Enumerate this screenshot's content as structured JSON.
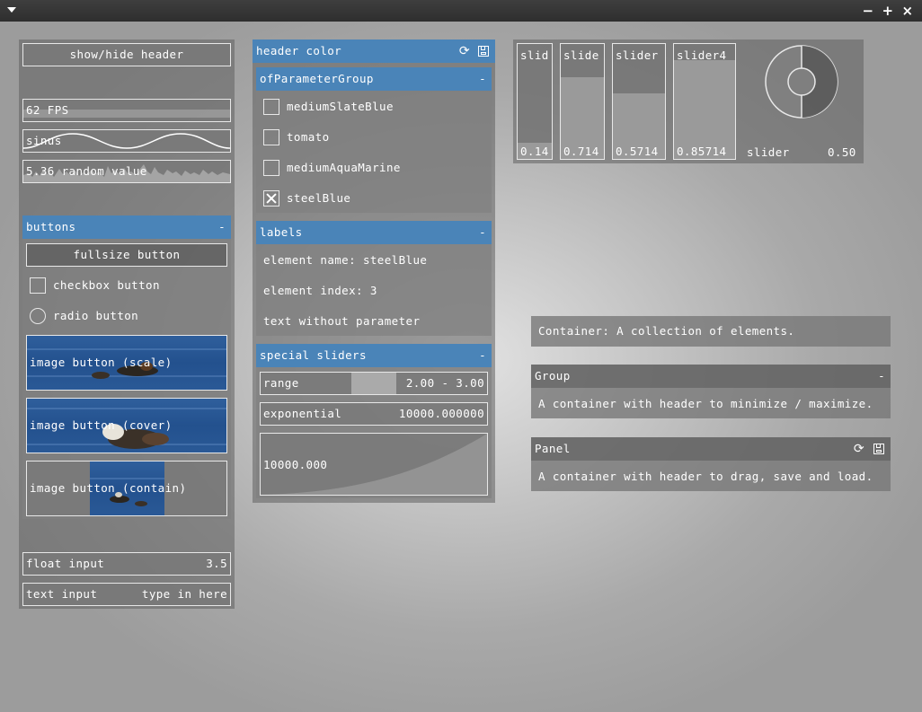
{
  "window": {
    "menu_icon": "chevron-down-icon",
    "controls": {
      "minimize": "−",
      "maximize": "+",
      "close": "×"
    }
  },
  "left": {
    "show_hide_header": "show/hide header",
    "fps": "62 FPS",
    "sinus": "sinus",
    "random": "5.36 random value",
    "buttons": {
      "header": "buttons",
      "minimize": "-",
      "fullsize": "fullsize button",
      "checkbox": "checkbox button",
      "radio": "radio button",
      "image_scale": "image button (scale)",
      "image_cover": "image button (cover)",
      "image_contain": "image button (contain)"
    },
    "float_input": {
      "label": "float input",
      "value": "3.5"
    },
    "text_input": {
      "label": "text input",
      "value": "type in here"
    }
  },
  "middle": {
    "header_color": "header color",
    "param_group": {
      "header": "ofParameterGroup",
      "minimize": "-",
      "items": [
        {
          "label": "mediumSlateBlue",
          "checked": false
        },
        {
          "label": "tomato",
          "checked": false
        },
        {
          "label": "mediumAquaMarine",
          "checked": false
        },
        {
          "label": "steelBlue",
          "checked": true
        }
      ]
    },
    "labels": {
      "header": "labels",
      "minimize": "-",
      "element_name": "element name: steelBlue",
      "element_index": "element index: 3",
      "text": "text without parameter"
    },
    "special_sliders": {
      "header": "special sliders",
      "minimize": "-",
      "range": {
        "label": "range",
        "value": "2.00 - 3.00",
        "low": 2.0,
        "high": 3.0
      },
      "exponential": {
        "label": "exponential",
        "value": "10000.000000"
      },
      "curve_value": "10000.000"
    }
  },
  "sliders": {
    "items": [
      {
        "label": "slid",
        "value": "0.14",
        "level": 0.14
      },
      {
        "label": "slide",
        "value": "0.714",
        "level": 0.714
      },
      {
        "label": "slider",
        "value": "0.5714",
        "level": 0.5714
      },
      {
        "label": "slider4",
        "value": "0.85714",
        "level": 0.85714
      }
    ],
    "knob": {
      "label": "slider",
      "value": "0.50",
      "level": 0.5
    }
  },
  "right": {
    "container": "Container: A collection of elements.",
    "group": {
      "header": "Group",
      "minimize": "-",
      "text": "A container with header to minimize / maximize."
    },
    "panel": {
      "header": "Panel",
      "text": "A container with header to drag, save and load."
    }
  }
}
